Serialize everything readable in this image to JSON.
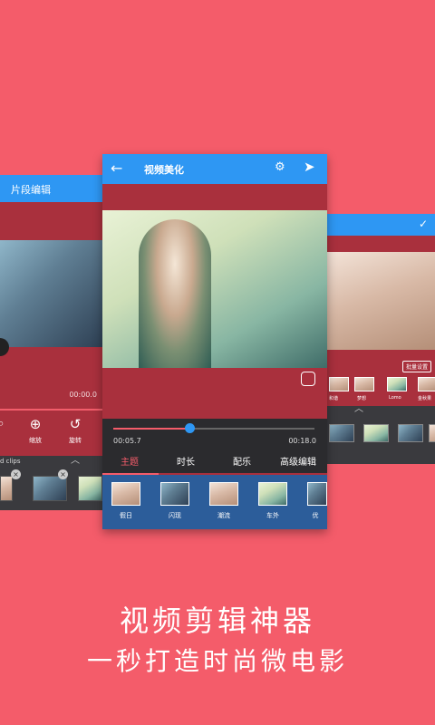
{
  "left_screen": {
    "title": "片段编辑",
    "time": "00:00.0",
    "tools": [
      {
        "label": "缩放",
        "icon": "zoom-in-icon"
      },
      {
        "label": "旋转",
        "icon": "rotate-icon"
      }
    ],
    "clips_label": "d clips"
  },
  "center_screen": {
    "title": "视频美化",
    "current_time": "00:05.7",
    "total_time": "00:18.0",
    "progress": 0.38,
    "tabs": [
      "主题",
      "时长",
      "配乐",
      "高级编辑"
    ],
    "active_tab": 0,
    "themes": [
      "假日",
      "闪现",
      "潮流",
      "车外",
      "优"
    ]
  },
  "right_screen": {
    "settings_button": "批量设置",
    "filters": [
      "和谐",
      "梦想",
      "Lomo",
      "金秋果"
    ]
  },
  "headline": "视频剪辑神器",
  "tagline": "一秒打造时尚微电影",
  "colors": {
    "background": "#f45c6a",
    "accent": "#2e97f3",
    "panel": "#a9303d"
  }
}
